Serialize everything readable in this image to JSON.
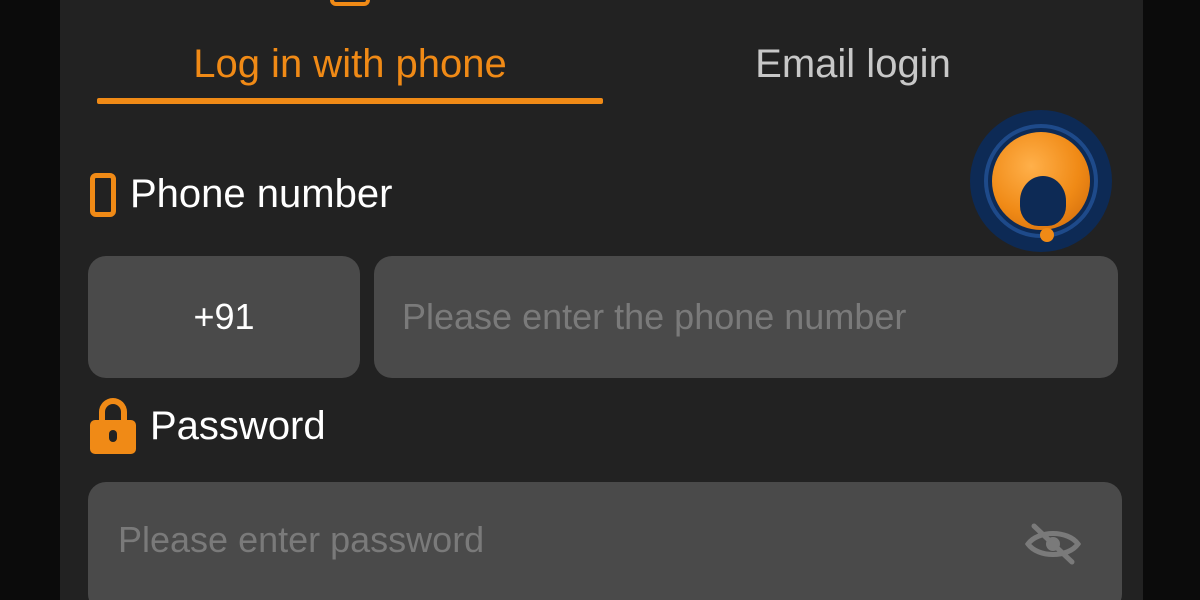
{
  "tabs": {
    "phone_label": "Log in with phone",
    "email_label": "Email login"
  },
  "phone": {
    "label": "Phone number",
    "country_code": "+91",
    "placeholder": "Please enter the phone number",
    "value": ""
  },
  "password": {
    "label": "Password",
    "placeholder": "Please enter password",
    "value": ""
  },
  "icons": {
    "tab_top": "login-tab-icon",
    "phone": "phone-icon",
    "lock": "lock-icon",
    "support": "customer-support-icon",
    "eye": "eye-hidden-icon"
  },
  "colors": {
    "accent": "#f08a16",
    "panel_bg": "#222222",
    "field_bg": "#4a4a4a",
    "inactive_tab": "#c8c8c8"
  }
}
